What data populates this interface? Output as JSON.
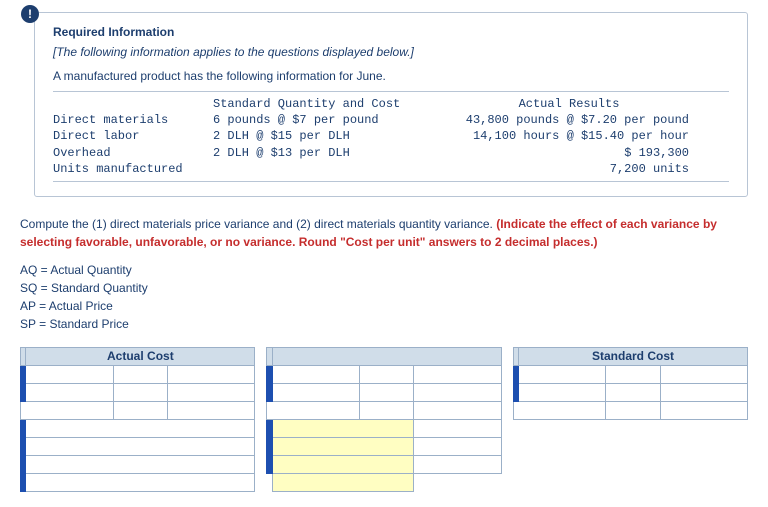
{
  "info": {
    "title": "Required Information",
    "note": "[The following information applies to the questions displayed below.]",
    "intro": "A manufactured product has the following information for June.",
    "col_headers": {
      "std": "Standard Quantity and Cost",
      "act": "Actual Results"
    },
    "rows": [
      {
        "label": "Direct materials",
        "std": "6 pounds @ $7 per pound",
        "act": "43,800 pounds @ $7.20 per pound"
      },
      {
        "label": "Direct labor",
        "std": "2 DLH @ $15 per DLH",
        "act": "14,100 hours @ $15.40 per hour"
      },
      {
        "label": "Overhead",
        "std": "2 DLH @ $13 per DLH",
        "act": "$ 193,300"
      },
      {
        "label": "Units manufactured",
        "std": "",
        "act": "7,200 units"
      }
    ]
  },
  "question": {
    "main": "Compute the (1) direct materials price variance and (2) direct materials quantity variance. ",
    "red": "(Indicate the effect of each variance by selecting favorable, unfavorable, or no variance. Round \"Cost per unit\" answers to 2 decimal places.)"
  },
  "legend": {
    "l1": "AQ = Actual Quantity",
    "l2": "SQ = Standard Quantity",
    "l3": "AP = Actual Price",
    "l4": "SP = Standard Price"
  },
  "worksheet": {
    "headers": {
      "left": "Actual Cost",
      "mid": "",
      "right": "Standard Cost"
    }
  }
}
